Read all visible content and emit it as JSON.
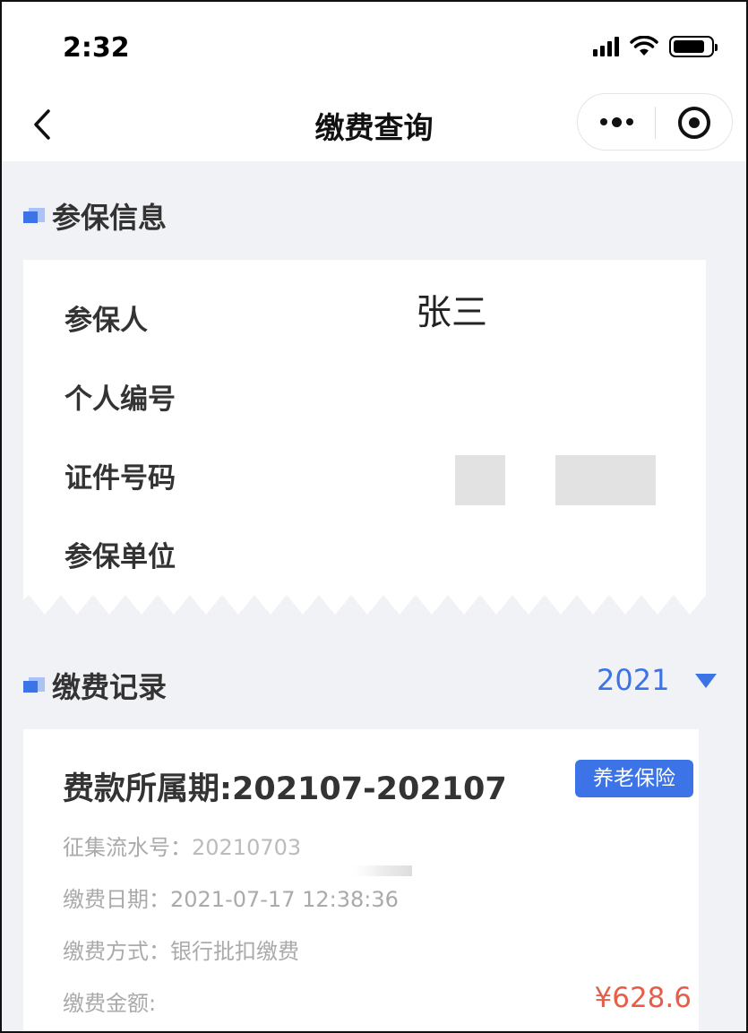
{
  "status_bar": {
    "time": "2:32"
  },
  "nav": {
    "title": "缴费查询"
  },
  "insured_info": {
    "section_title": "参保信息",
    "rows": [
      {
        "label": "参保人",
        "value": "张三"
      },
      {
        "label": "个人编号",
        "value": ""
      },
      {
        "label": "证件号码",
        "value": ""
      },
      {
        "label": "参保单位",
        "value": ""
      }
    ]
  },
  "records": {
    "section_title": "缴费记录",
    "year": "2021",
    "items": [
      {
        "period": "费款所属期:202107-202107",
        "tag": "养老保险",
        "serial_label": "征集流水号：",
        "serial_value": "20210703",
        "date_label": "缴费日期：",
        "date_value": "2021-07-17 12:38:36",
        "method_label": "缴费方式：",
        "method_value": "银行批扣缴费",
        "amount_label": "缴费金额:",
        "amount_value": "¥628.6"
      }
    ]
  },
  "colors": {
    "accent": "#3c74e8",
    "amount": "#e45e4a",
    "background": "#f1f2f6"
  }
}
